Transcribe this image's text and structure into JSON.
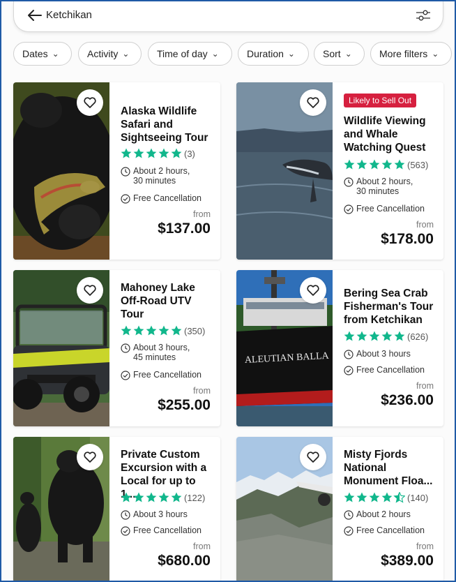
{
  "search": {
    "query": "Ketchikan"
  },
  "filters": [
    {
      "label": "Dates"
    },
    {
      "label": "Activity"
    },
    {
      "label": "Time of day"
    },
    {
      "label": "Duration"
    },
    {
      "label": "Sort"
    },
    {
      "label": "More filters"
    }
  ],
  "listings": [
    {
      "title_lines": [
        "Alaska Wildlife",
        "Safari and",
        "Sightseeing Tour"
      ],
      "rating_stars": 5,
      "review_count": "(3)",
      "duration_lines": [
        "About 2 hours,",
        "30 minutes"
      ],
      "cancellation": "Free Cancellation",
      "from_label": "from",
      "price": "$137.00",
      "badge": ""
    },
    {
      "title_lines": [
        "Wildlife Viewing",
        "and Whale",
        "Watching Quest"
      ],
      "rating_stars": 5,
      "review_count": "(563)",
      "duration_lines": [
        "About 2 hours,",
        "30 minutes"
      ],
      "cancellation": "Free Cancellation",
      "from_label": "from",
      "price": "$178.00",
      "badge": "Likely to Sell Out"
    },
    {
      "title_lines": [
        "Mahoney Lake",
        "Off-Road UTV",
        "Tour"
      ],
      "rating_stars": 5,
      "review_count": "(350)",
      "duration_lines": [
        "About 3 hours,",
        "45 minutes"
      ],
      "cancellation": "Free Cancellation",
      "from_label": "from",
      "price": "$255.00",
      "badge": ""
    },
    {
      "title_lines": [
        "Bering Sea Crab",
        "Fisherman's Tour",
        "from Ketchikan"
      ],
      "rating_stars": 5,
      "review_count": "(626)",
      "duration_lines": [
        "About 3 hours"
      ],
      "cancellation": "Free Cancellation",
      "from_label": "from",
      "price": "$236.00",
      "badge": ""
    },
    {
      "title_lines": [
        "Private Custom",
        "Excursion with a",
        "Local for up to 1..."
      ],
      "rating_stars": 5,
      "review_count": "(122)",
      "duration_lines": [
        "About 3 hours"
      ],
      "cancellation": "Free Cancellation",
      "from_label": "from",
      "price": "$680.00",
      "badge": ""
    },
    {
      "title_lines": [
        "Misty Fjords",
        "National",
        "Monument Floa..."
      ],
      "rating_stars": 4.5,
      "review_count": "(140)",
      "duration_lines": [
        "About 2 hours"
      ],
      "cancellation": "Free Cancellation",
      "from_label": "from",
      "price": "$389.00",
      "badge": ""
    }
  ],
  "boat_name": "ALEUTIAN BALLA",
  "colors": {
    "star": "#11b78c",
    "badge": "#d6203f",
    "text": "#111111"
  }
}
